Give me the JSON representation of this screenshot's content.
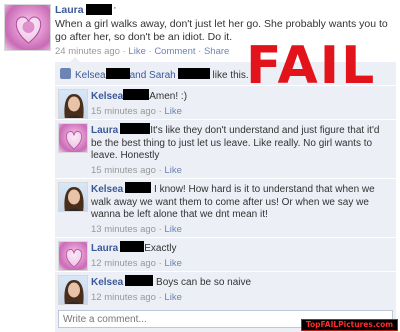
{
  "post": {
    "author": "Laura",
    "dot": "·",
    "text": "When a girl walks away, don't just let her go. She probably wants you to go after her, so don't be an idiot. Do it.",
    "time": "24 minutes ago",
    "sep": "·",
    "like": "Like",
    "comment": "Comment",
    "share": "Share"
  },
  "likes": {
    "name1": "Kelsea",
    "and": "and Sarah",
    "suffix": "like this."
  },
  "comments": [
    {
      "author": "Kelsea",
      "text": "Amen! :)",
      "time": "15 minutes ago",
      "sep": "·",
      "like": "Like",
      "avatar": "girl-photo"
    },
    {
      "author": "Laura",
      "text": "It's like they don't understand and just figure that it'd be the best thing to just let us leave. Like really. No girl wants to leave. Honestly",
      "time": "15 minutes ago",
      "sep": "·",
      "like": "Like",
      "avatar": "heart-photo"
    },
    {
      "author": "Kelsea",
      "text": "I know! How hard is it to understand that when we walk away we want them to come after us! Or when we say we wanna be left alone that we dnt mean it!",
      "time": "13 minutes ago",
      "sep": "·",
      "like": "Like",
      "avatar": "girl-photo"
    },
    {
      "author": "Laura",
      "text": "Exactly",
      "time": "12 minutes ago",
      "sep": "·",
      "like": "Like",
      "avatar": "heart-photo"
    },
    {
      "author": "Kelsea",
      "text": "Boys can be so naive",
      "time": "12 minutes ago",
      "sep": "·",
      "like": "Like",
      "avatar": "girl-photo"
    }
  ],
  "overlay": {
    "fail": "FAIL",
    "watermark": "TopFAILPictures.com"
  },
  "input": {
    "placeholder": "Write a comment..."
  },
  "colors": {
    "link_blue": "#3b5998",
    "comment_bg": "#eceff5",
    "fail_red": "#e3131b"
  }
}
